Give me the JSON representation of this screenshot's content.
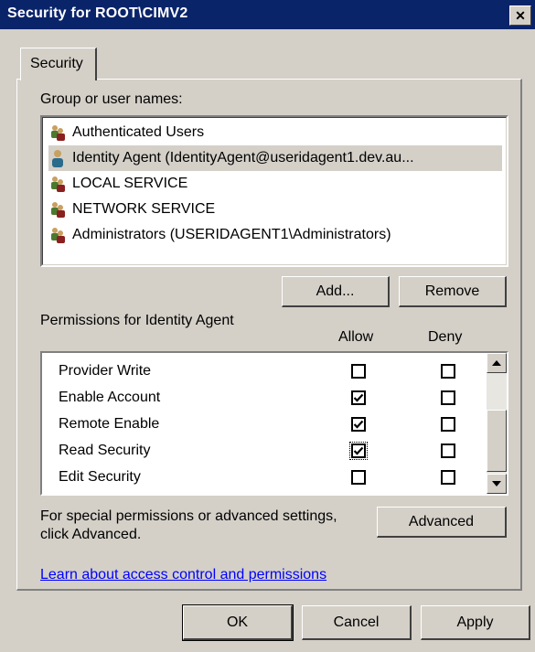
{
  "window": {
    "title": "Security for ROOT\\CIMV2",
    "close_glyph": "✕"
  },
  "tab": {
    "label": "Security"
  },
  "group_section": {
    "label": "Group or user names:",
    "users": [
      {
        "name": "Authenticated Users",
        "icon": "user-group-icon",
        "selected": false
      },
      {
        "name": "Identity Agent (IdentityAgent@useridagent1.dev.au...",
        "icon": "single-user-icon",
        "selected": true
      },
      {
        "name": "LOCAL SERVICE",
        "icon": "user-group-icon",
        "selected": false
      },
      {
        "name": "NETWORK SERVICE",
        "icon": "user-group-icon",
        "selected": false
      },
      {
        "name": "Administrators (USERIDAGENT1\\Administrators)",
        "icon": "user-group-icon",
        "selected": false
      }
    ],
    "add_label": "Add...",
    "remove_label": "Remove"
  },
  "permissions": {
    "label": "Permissions for Identity Agent",
    "allow_header": "Allow",
    "deny_header": "Deny",
    "rows": [
      {
        "name": "Provider Write",
        "allow": false,
        "deny": false
      },
      {
        "name": "Enable Account",
        "allow": true,
        "deny": false
      },
      {
        "name": "Remote Enable",
        "allow": true,
        "deny": false
      },
      {
        "name": "Read Security",
        "allow": true,
        "deny": false
      },
      {
        "name": "Edit Security",
        "allow": false,
        "deny": false
      }
    ]
  },
  "advanced": {
    "text_line1": "For special permissions or advanced settings,",
    "text_line2": "click Advanced.",
    "button_label": "Advanced"
  },
  "link_text": "Learn about access control and permissions",
  "footer": {
    "ok_label": "OK",
    "cancel_label": "Cancel",
    "apply_label": "Apply"
  },
  "colors": {
    "titlebar": "#0a246a",
    "face": "#d4d0c8",
    "link": "#0000ff"
  }
}
